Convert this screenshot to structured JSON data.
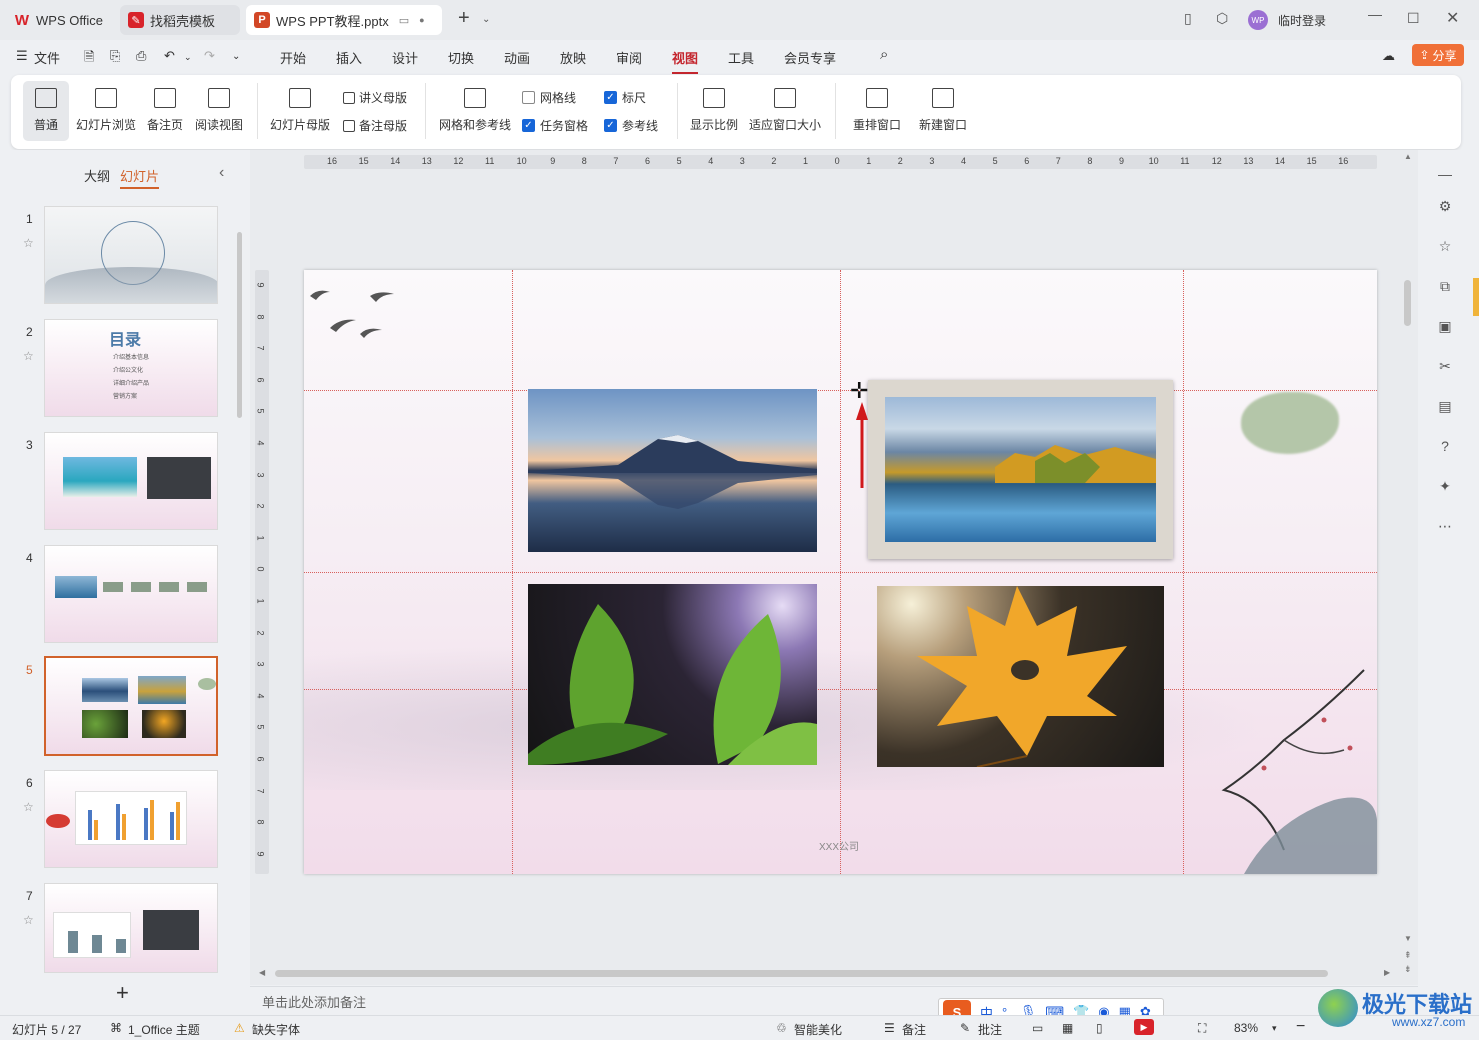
{
  "tabs": {
    "wps": "WPS Office",
    "template": "找稻壳模板",
    "doc": "WPS PPT教程.pptx"
  },
  "titlebar": {
    "user": "临时登录",
    "user_initials": "WP"
  },
  "menu": {
    "file": "文件",
    "items": [
      "开始",
      "插入",
      "设计",
      "切换",
      "动画",
      "放映",
      "审阅",
      "视图",
      "工具",
      "会员专享"
    ],
    "active": "视图",
    "share": "分享"
  },
  "ribbon": {
    "normal": "普通",
    "slide_sorter": "幻灯片浏览",
    "notes_page": "备注页",
    "reading_view": "阅读视图",
    "slide_master": "幻灯片母版",
    "handout_master": "讲义母版",
    "notes_master": "备注母版",
    "grid_guides": "网格和参考线",
    "gridlines": {
      "label": "网格线",
      "checked": false
    },
    "task_pane": {
      "label": "任务窗格",
      "checked": true
    },
    "ruler": {
      "label": "标尺",
      "checked": true
    },
    "guides": {
      "label": "参考线",
      "checked": true
    },
    "zoom": "显示比例",
    "fit_window": "适应窗口大小",
    "arrange": "重排窗口",
    "new_window": "新建窗口"
  },
  "leftpanel": {
    "outline_tab": "大纲",
    "slides_tab": "幻灯片",
    "numbers": [
      "1",
      "2",
      "3",
      "4",
      "5",
      "6",
      "7"
    ],
    "selected": "5",
    "slide2_title": "目录",
    "slide2_items": [
      "介绍基本信息",
      "介绍公文化",
      "详细介绍产品",
      "营销方案"
    ]
  },
  "ruler": {
    "h_ticks": [
      "16",
      "15",
      "14",
      "13",
      "12",
      "11",
      "10",
      "9",
      "8",
      "7",
      "6",
      "5",
      "4",
      "3",
      "2",
      "1",
      "0",
      "1",
      "2",
      "3",
      "4",
      "5",
      "6",
      "7",
      "8",
      "9",
      "10",
      "11",
      "12",
      "13",
      "14",
      "15",
      "16"
    ],
    "v_ticks": [
      "9",
      "8",
      "7",
      "6",
      "5",
      "4",
      "3",
      "2",
      "1",
      "0",
      "1",
      "2",
      "3",
      "4",
      "5",
      "6",
      "7",
      "8",
      "9"
    ]
  },
  "slide": {
    "footer": "XXX公司"
  },
  "notes": {
    "placeholder": "单击此处添加备注"
  },
  "status": {
    "slide_count": "幻灯片 5 / 27",
    "theme": "1_Office 主题",
    "missing_font": "缺失字体",
    "beautify": "智能美化",
    "notes": "备注",
    "comments": "批注",
    "zoom": "83%"
  },
  "ime": {
    "mode": "中"
  },
  "watermark": {
    "name": "极光下载站",
    "url": "www.xz7.com"
  }
}
